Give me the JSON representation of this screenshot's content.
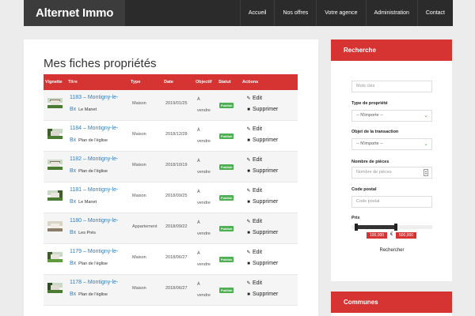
{
  "brand": "Alternet Immo",
  "nav": [
    "Accueil",
    "Nos offres",
    "Votre agence",
    "Administration",
    "Contact"
  ],
  "page_title": "Mes fiches propriétés",
  "table": {
    "headers": {
      "thumb": "Vignette",
      "title": "Titre",
      "type": "Type",
      "date": "Date",
      "objective": "Objectif",
      "status": "Statut",
      "actions": "Actions"
    },
    "rows": [
      {
        "line1": "1183 – Montigny-le-",
        "line2": "Bx",
        "loc": "Le Manet",
        "type": "Maison",
        "date": "2019/01/25",
        "obj1": "À",
        "obj2": "vendre",
        "status": "Publish"
      },
      {
        "line1": "1184 – Montigny-le-",
        "line2": "Bx",
        "loc": "Plan de l'église",
        "type": "Maison",
        "date": "2018/12/28",
        "obj1": "À",
        "obj2": "vendre",
        "status": "Publish"
      },
      {
        "line1": "1182 – Montigny-le-",
        "line2": "Bx",
        "loc": "Plan de l'église",
        "type": "Maison",
        "date": "2018/10/19",
        "obj1": "À",
        "obj2": "vendre",
        "status": "Publish"
      },
      {
        "line1": "1181 – Montigny-le-",
        "line2": "Bx",
        "loc": "Le Manet",
        "type": "Maison",
        "date": "2018/09/25",
        "obj1": "À",
        "obj2": "vendre",
        "status": "Publish"
      },
      {
        "line1": "1180 – Montigny-le-",
        "line2": "Bx",
        "loc": "Les Prés",
        "type": "Appartement",
        "date": "2018/09/22",
        "obj1": "À",
        "obj2": "vendre",
        "status": "Publish"
      },
      {
        "line1": "1179 – Montigny-le-",
        "line2": "Bx",
        "loc": "Plan de l'église",
        "type": "Maison",
        "date": "2018/06/27",
        "obj1": "À",
        "obj2": "vendre",
        "status": "Publish"
      },
      {
        "line1": "1178 – Montigny-le-",
        "line2": "Bx",
        "loc": "Plan de l'église",
        "type": "Maison",
        "date": "2018/06/27",
        "obj1": "À",
        "obj2": "vendre",
        "status": "Publish"
      }
    ],
    "edit_label": "Edit",
    "delete_label": "Supprimer"
  },
  "sidebar": {
    "search_title": "Recherche",
    "keywords_placeholder": "Mots clés",
    "property_type_label": "Type de propriété",
    "property_type_value": "-- N'importe --",
    "transaction_label": "Objet de la transaction",
    "transaction_value": "-- N'importe --",
    "rooms_label": "Nombre de pièces",
    "rooms_placeholder": "Nombre de pièces",
    "postal_label": "Code postal",
    "postal_placeholder": "Code postal",
    "price_label": "Prix",
    "price_min": "100,000",
    "price_max": "500,000",
    "currency": "€",
    "search_button": "Rechercher",
    "communes_title": "Communes"
  },
  "colors": {
    "accent": "#d63333",
    "nav_bg": "#2b2b2b",
    "link": "#2a7fc8",
    "status": "#4caf50"
  }
}
